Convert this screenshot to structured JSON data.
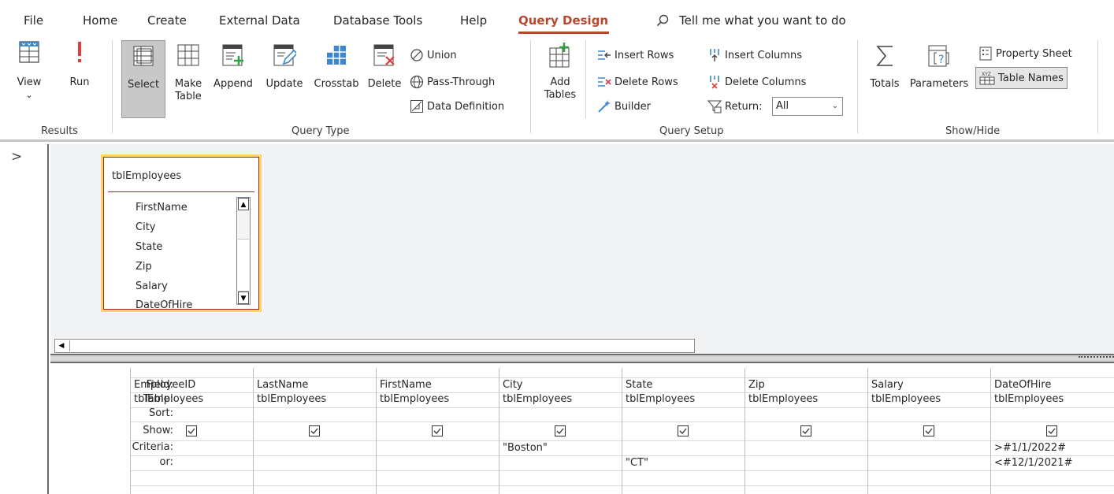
{
  "menu": {
    "tabs": [
      "File",
      "Home",
      "Create",
      "External Data",
      "Database Tools",
      "Help",
      "Query Design"
    ],
    "active_tab": "Query Design",
    "tell_me": "Tell me what you want to do"
  },
  "ribbon": {
    "results": {
      "label": "Results",
      "view": "View",
      "view_chevron": "⌄",
      "run": "Run"
    },
    "query_type": {
      "label": "Query Type",
      "select": "Select",
      "make_table": [
        "Make",
        "Table"
      ],
      "append": "Append",
      "update": "Update",
      "crosstab": "Crosstab",
      "delete": "Delete",
      "union": "Union",
      "pass_through": "Pass-Through",
      "data_definition": "Data Definition"
    },
    "query_setup": {
      "label": "Query Setup",
      "add_tables": [
        "Add",
        "Tables"
      ],
      "insert_rows": "Insert Rows",
      "delete_rows": "Delete Rows",
      "builder": "Builder",
      "insert_columns": "Insert Columns",
      "delete_columns": "Delete Columns",
      "return_label": "Return:",
      "return_value": "All"
    },
    "show_hide": {
      "label": "Show/Hide",
      "totals": "Totals",
      "parameters": "Parameters",
      "property_sheet": "Property Sheet",
      "table_names": "Table Names"
    }
  },
  "nav_pane": {
    "chevron": ">"
  },
  "table_box": {
    "title": "tblEmployees",
    "fields": [
      "FirstName",
      "City",
      "State",
      "Zip",
      "Salary",
      "DateOfHire"
    ]
  },
  "grid": {
    "row_labels": [
      "Field:",
      "Table:",
      "Sort:",
      "Show:",
      "Criteria:",
      "or:"
    ],
    "columns": [
      {
        "field": "EmployeeID",
        "table": "tblEmployees",
        "show": true,
        "criteria": "",
        "or": ""
      },
      {
        "field": "LastName",
        "table": "tblEmployees",
        "show": true,
        "criteria": "",
        "or": ""
      },
      {
        "field": "FirstName",
        "table": "tblEmployees",
        "show": true,
        "criteria": "",
        "or": ""
      },
      {
        "field": "City",
        "table": "tblEmployees",
        "show": true,
        "criteria": "\"Boston\"",
        "or": ""
      },
      {
        "field": "State",
        "table": "tblEmployees",
        "show": true,
        "criteria": "",
        "or": "\"CT\""
      },
      {
        "field": "Zip",
        "table": "tblEmployees",
        "show": true,
        "criteria": "",
        "or": ""
      },
      {
        "field": "Salary",
        "table": "tblEmployees",
        "show": true,
        "criteria": "",
        "or": ""
      },
      {
        "field": "DateOfHire",
        "table": "tblEmployees",
        "show": true,
        "criteria": ">#1/1/2022#",
        "or": "<#12/1/2021#"
      }
    ]
  },
  "colors": {
    "accent": "#b7472a",
    "table_border": "#a4262c",
    "selection_outline": "#ffd466",
    "design_background": "#f0f2f4"
  }
}
